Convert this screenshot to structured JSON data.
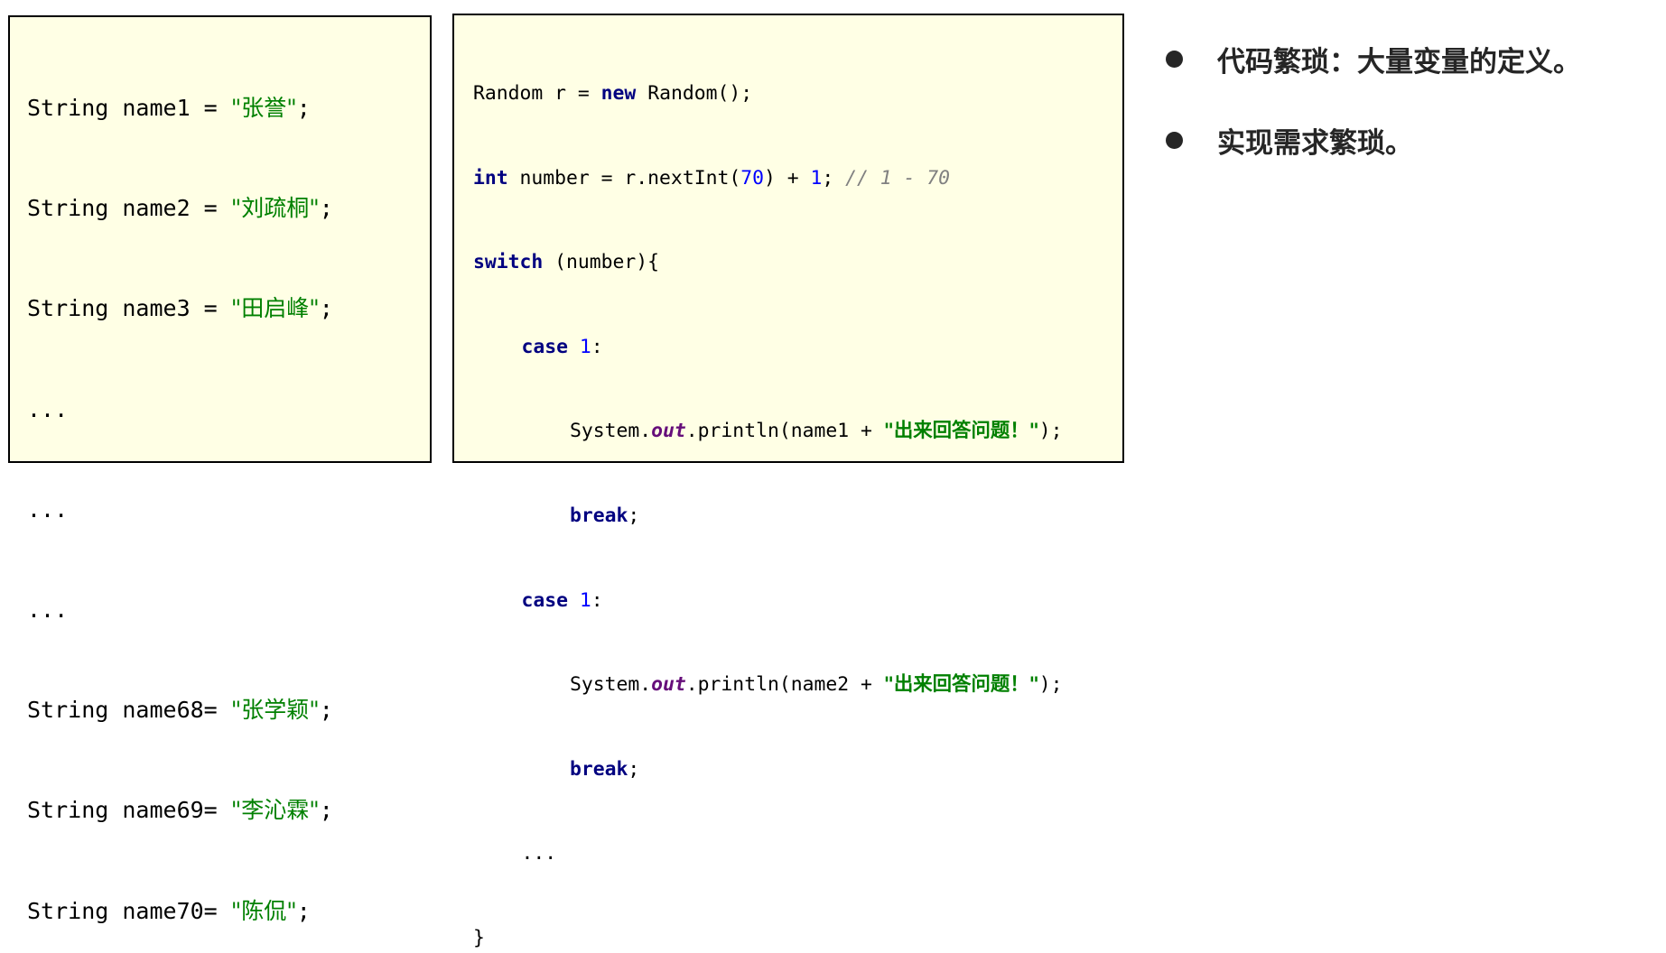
{
  "left_code": {
    "lines": [
      {
        "type": "decl",
        "prefix": "String name1 = ",
        "string": "\"张誉\"",
        "suffix": ";"
      },
      {
        "type": "decl",
        "prefix": "String name2 = ",
        "string": "\"刘疏桐\"",
        "suffix": ";"
      },
      {
        "type": "decl",
        "prefix": "String name3 = ",
        "string": "\"田启峰\"",
        "suffix": ";"
      },
      {
        "type": "ellipsis",
        "text": "..."
      },
      {
        "type": "ellipsis",
        "text": "..."
      },
      {
        "type": "ellipsis",
        "text": "..."
      },
      {
        "type": "decl",
        "prefix": "String name68= ",
        "string": "\"张学颖\"",
        "suffix": ";"
      },
      {
        "type": "decl",
        "prefix": "String name69= ",
        "string": "\"李沁霖\"",
        "suffix": ";"
      },
      {
        "type": "decl",
        "prefix": "String name70= ",
        "string": "\"陈侃\"",
        "suffix": ";"
      }
    ]
  },
  "mid_code": {
    "line1": {
      "a": "Random r = ",
      "kw": "new",
      "b": " Random();"
    },
    "line2": {
      "kw": "int",
      "a": " number = r.nextInt(",
      "n1": "70",
      "b": ") + ",
      "n2": "1",
      "c": "; ",
      "comment": "// 1 - 70"
    },
    "line3": {
      "kw": "switch",
      "a": " (number){"
    },
    "case1": {
      "kw": "case",
      "sp": " ",
      "num": "1",
      "colon": ":"
    },
    "print1": {
      "a": "System.",
      "field": "out",
      "b": ".println(name1 + ",
      "str": "\"出来回答问题！\"",
      "c": ");"
    },
    "break1": {
      "kw": "break",
      "semi": ";"
    },
    "case2": {
      "kw": "case",
      "sp": " ",
      "num": "1",
      "colon": ":"
    },
    "print2": {
      "a": "System.",
      "field": "out",
      "b": ".println(name2 + ",
      "str": "\"出来回答问题！\"",
      "c": ");"
    },
    "break2": {
      "kw": "break",
      "semi": ";"
    },
    "ellipsis": "...",
    "close": "}"
  },
  "bullets": [
    {
      "text": "代码繁琐：大量变量的定义。"
    },
    {
      "text": "实现需求繁琐。"
    }
  ],
  "colors": {
    "box_background": "#ffffe5",
    "keyword": "#000080",
    "number": "#0000ff",
    "string": "#008000",
    "comment": "#808080",
    "static_field": "#660e7a",
    "bullet_text": "#262626"
  }
}
